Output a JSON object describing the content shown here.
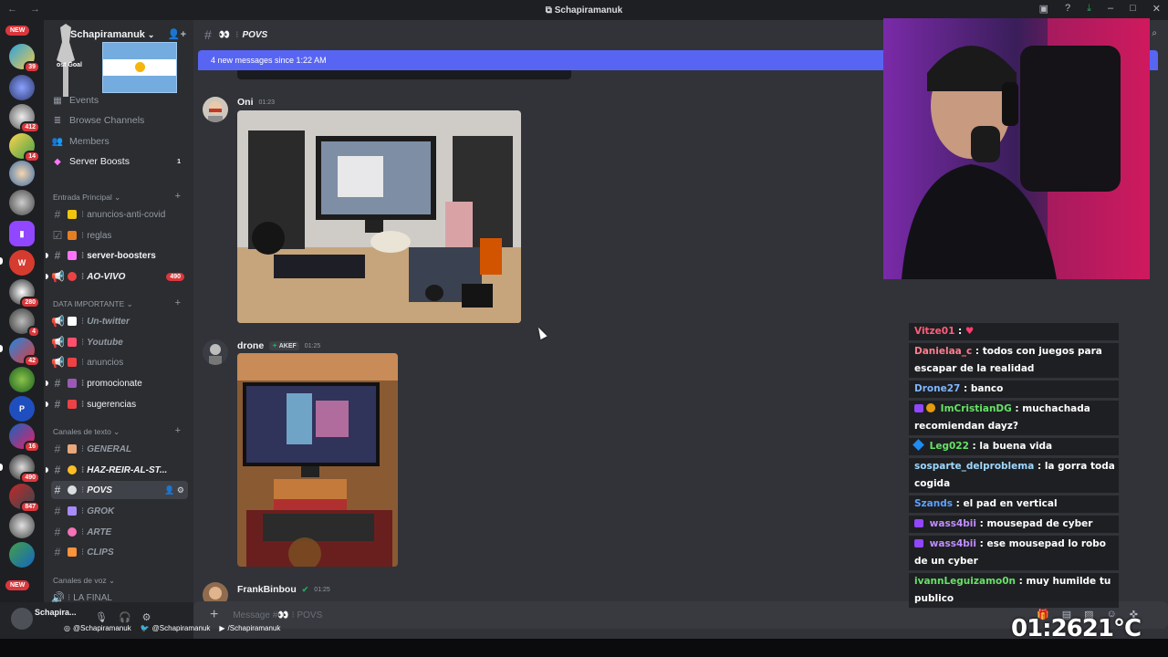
{
  "window": {
    "title": "Schapiramanuk",
    "colors": {
      "blurple": "#5865f2",
      "danger": "#da373c",
      "online": "#23a55a"
    }
  },
  "guilds": {
    "new_top": "NEW",
    "new_bottom": "NEW",
    "badges": [
      "39",
      "412",
      "14",
      "280",
      "4",
      "42",
      "16",
      "490",
      "847"
    ]
  },
  "server": {
    "name": "Schapiramanuk",
    "boost_goal": "ost Goal",
    "items": [
      {
        "label": "Events",
        "icon": "calendar-icon"
      },
      {
        "label": "Browse Channels",
        "icon": "browse-icon"
      },
      {
        "label": "Members",
        "icon": "members-icon"
      },
      {
        "label": "Server Boosts",
        "icon": "boost-icon",
        "count": "1"
      }
    ],
    "categories": [
      {
        "label": "Entrada Principal",
        "channels": [
          {
            "name": "anuncios-anti-covid",
            "emoji_color": "#f1c40f"
          },
          {
            "name": "reglas",
            "emoji_color": "#e67e22"
          },
          {
            "name": "server-boosters",
            "emoji_color": "#ff73fa"
          },
          {
            "name": "AO-VIVO",
            "emoji_color": "#ed4245",
            "count": "490"
          }
        ]
      },
      {
        "label": "DATA IMPORTANTE",
        "channels": [
          {
            "name": "Un-twitter",
            "emoji_color": "#ffffff"
          },
          {
            "name": "Youtube",
            "emoji_color": "#ff4f6d"
          },
          {
            "name": "anuncios",
            "emoji_color": "#ed4245"
          },
          {
            "name": "promocionate",
            "emoji_color": "#9b59b6"
          },
          {
            "name": "sugerencias",
            "emoji_color": "#ed4245"
          }
        ]
      },
      {
        "label": "Canales de texto",
        "channels": [
          {
            "name": "GENERAL",
            "emoji_color": "#e8a87c"
          },
          {
            "name": "HAZ-REIR-AL-ST...",
            "emoji_color": "#fbbf24"
          },
          {
            "name": "POVS",
            "emoji_color": "#dbdee1"
          },
          {
            "name": "GROK",
            "emoji_color": "#a78bfa"
          },
          {
            "name": "ARTE",
            "emoji_color": "#f472b6"
          },
          {
            "name": "CLIPS",
            "emoji_color": "#fb923c"
          }
        ]
      },
      {
        "label": "Canales de voz",
        "channels": [
          {
            "name": "LA FINAL"
          }
        ]
      }
    ]
  },
  "user_panel": {
    "name": "Schapira..."
  },
  "channel": {
    "name": "POVS",
    "new_messages": "4 new messages since 1:22 AM",
    "composer_placeholder": "Message #👀 ⁝ POVS"
  },
  "messages": [
    {
      "author": "Oni",
      "time": "01:23"
    },
    {
      "author": "drone",
      "tag": "AKEF",
      "time": "01:25"
    },
    {
      "author": "FrankBinbou",
      "time": "01:25"
    }
  ],
  "stream_chat": [
    {
      "user": "Vitze01",
      "color": "#ff5d7a",
      "text": ""
    },
    {
      "user": "Danielaa_c",
      "color": "#ff7d8f",
      "text": "todos con juegos para escapar de la realidad"
    },
    {
      "user": "Drone27",
      "color": "#7fb6ff",
      "text": "banco"
    },
    {
      "user": "ImCristianDG",
      "color": "#66e266",
      "text": "muchachada recomiendan dayz?",
      "badges": [
        "sub",
        "medal"
      ]
    },
    {
      "user": "Leg022",
      "color": "#66e266",
      "text": "la buena vida",
      "badges": [
        "gem"
      ]
    },
    {
      "user": "sosparte_delproblema",
      "color": "#9fd8ff",
      "text": "la gorra toda cogida"
    },
    {
      "user": "Szands",
      "color": "#5aa2ff",
      "text": "el pad en vertical"
    },
    {
      "user": "wass4bii",
      "color": "#c08cff",
      "text": "mousepad de cyber",
      "badges": [
        "sub"
      ]
    },
    {
      "user": "wass4bii",
      "color": "#c08cff",
      "text": "ese mousepad lo robo de un cyber",
      "badges": [
        "sub"
      ]
    },
    {
      "user": "ivannLeguizamo0n",
      "color": "#66e266",
      "text": "muy humilde tu publico"
    }
  ],
  "socials": {
    "instagram": "@Schapiramanuk",
    "twitter": "@Schapiramanuk",
    "youtube": "/Schapiramanuk"
  },
  "overlay_clock": {
    "time": "01:26",
    "temp": "21°C"
  }
}
